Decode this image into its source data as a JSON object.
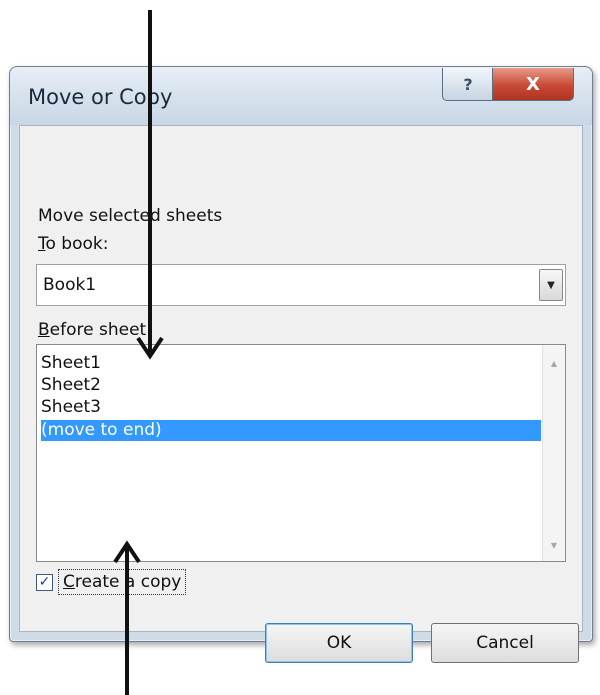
{
  "dialog": {
    "title": "Move or Copy",
    "help_icon": "question-mark-icon",
    "close_icon": "close-x-icon",
    "help_glyph": "?",
    "close_glyph": "X"
  },
  "move_selected_label": "Move selected sheets",
  "to_book": {
    "label_underlined": "T",
    "label_rest": "o book:",
    "value": "Book1"
  },
  "before_sheet": {
    "label_underlined": "B",
    "label_rest": "efore sheet:",
    "items": [
      "Sheet1",
      "Sheet2",
      "Sheet3",
      "(move to end)"
    ],
    "selected_index": 3
  },
  "create_copy": {
    "checked": true,
    "label_underlined": "C",
    "label_rest": "reate a copy"
  },
  "buttons": {
    "ok": "OK",
    "cancel": "Cancel"
  },
  "colors": {
    "selection": "#3399ff",
    "close_button": "#c74a36",
    "annotation_arrow": "#111111"
  }
}
